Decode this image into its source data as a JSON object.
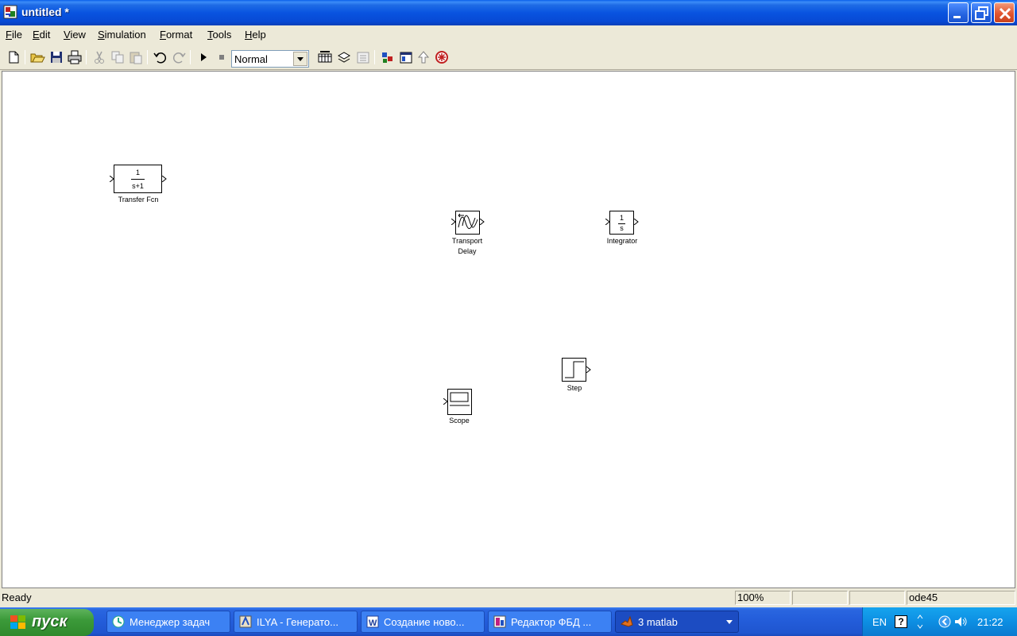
{
  "window": {
    "title": "untitled *",
    "buttons": {
      "minimize": "minimize",
      "maximize": "maximize",
      "close": "close"
    }
  },
  "menu": {
    "items": [
      {
        "label": "File",
        "key": "F",
        "rest": "ile"
      },
      {
        "label": "Edit",
        "key": "E",
        "rest": "dit"
      },
      {
        "label": "View",
        "key": "V",
        "rest": "iew"
      },
      {
        "label": "Simulation",
        "key": "S",
        "rest": "imulation"
      },
      {
        "label": "Format",
        "key": "F",
        "rest": "ormat"
      },
      {
        "label": "Tools",
        "key": "T",
        "rest": "ools"
      },
      {
        "label": "Help",
        "key": "H",
        "rest": "elp"
      }
    ]
  },
  "toolbar": {
    "mode": "Normal"
  },
  "blocks": {
    "transfer_fcn": {
      "num": "1",
      "den": "s+1",
      "label": "Transfer Fcn"
    },
    "transport_delay": {
      "label1": "Transport",
      "label2": "Delay"
    },
    "integrator": {
      "num": "1",
      "den": "s",
      "label": "Integrator"
    },
    "step": {
      "label": "Step"
    },
    "scope": {
      "label": "Scope"
    }
  },
  "status": {
    "text": "Ready",
    "zoom": "100%",
    "cell2": "",
    "cell3": "",
    "solver": "ode45"
  },
  "taskbar": {
    "start": "пуск",
    "tasks": [
      {
        "label": "Менеджер задач"
      },
      {
        "label": "ILYA - Генерато..."
      },
      {
        "label": "Создание ново..."
      },
      {
        "label": "Редактор ФБД ..."
      },
      {
        "label": "3 matlab"
      }
    ],
    "tray": {
      "lang": "EN",
      "time": "21:22"
    }
  }
}
